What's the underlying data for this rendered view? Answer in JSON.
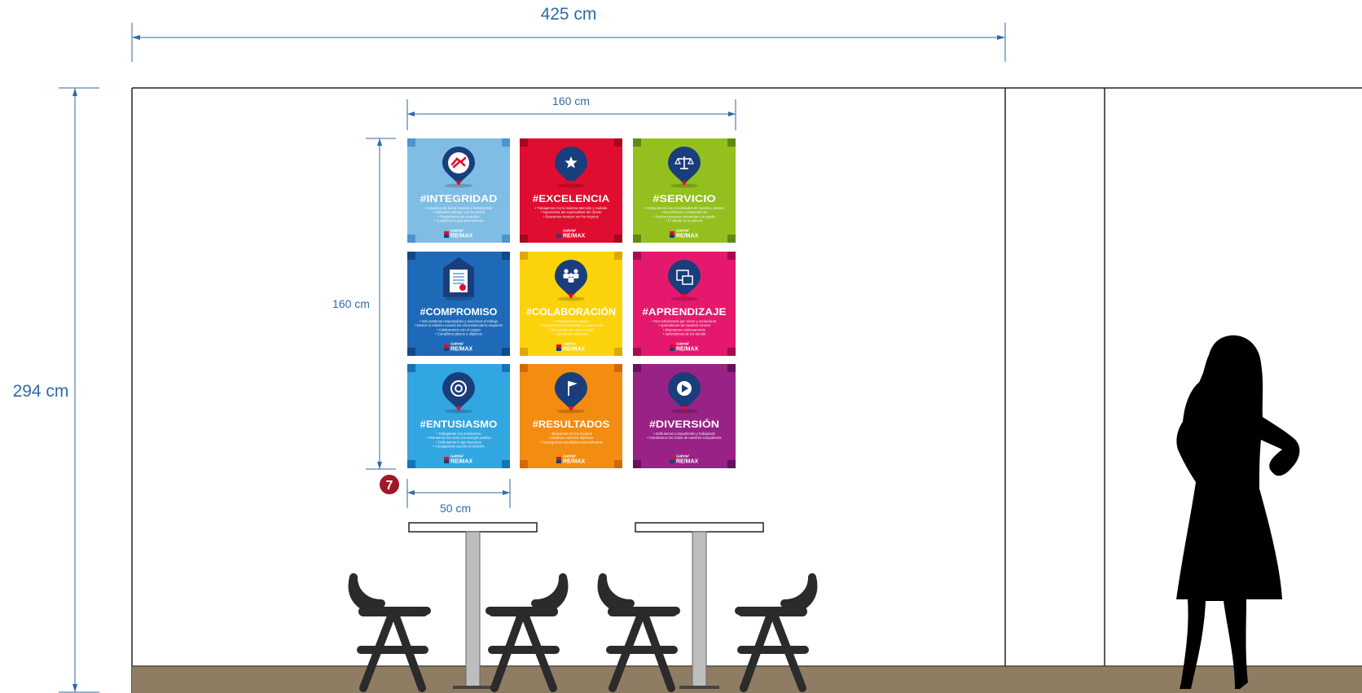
{
  "dimensions": {
    "wall_width": "425 cm",
    "wall_height": "294 cm",
    "grid_width": "160 cm",
    "grid_height": "160 cm",
    "panel_width": "50 cm"
  },
  "badge": "7",
  "colors": {
    "dimension_line": "#2f6aa6",
    "wall_line": "#222222",
    "floor": "#8e7d63",
    "icon_pin": "#1a3e7c",
    "furniture": "#2b2b2b",
    "badge": "#a3162a"
  },
  "logo": {
    "top": "Gabriel",
    "main": "RE/MAX"
  },
  "panels": [
    {
      "title": "#INTEGRIDAD",
      "icon": "handshake-icon",
      "bg": "#7fbde4",
      "corner": "#4d95cf",
      "lines": [
        "Actuamos de forma honesta y transparente",
        "Hablamos siempre con la verdad",
        "Respetamos los acuerdos",
        "Cumplimos lo que prometemos"
      ]
    },
    {
      "title": "#EXCELENCIA",
      "icon": "star-icon",
      "bg": "#df0d2f",
      "corner": "#a80620",
      "lines": [
        "Trabajamos con la máxima atención y cuidado",
        "Superamos las expectativas del cliente",
        "Buscamos siempre ser los mejores"
      ]
    },
    {
      "title": "#SERVICIO",
      "icon": "scales-icon",
      "bg": "#93c01f",
      "corner": "#5f8a14",
      "lines": [
        "Anteponemos las necesidades de nuestros clientes",
        "Escuchamos y respondemos",
        "Somos personas orientadas a la ayuda",
        "El cliente es lo primero"
      ]
    },
    {
      "title": "#COMPROMISO",
      "icon": "certificate-icon",
      "bg": "#1e6ab8",
      "corner": "#0f4a8a",
      "lines": [
        "Nos sentimos responsables y asumimos el trabajo",
        "Damos el máximo cuando las circunstancias lo requieren",
        "Colaboramos con el equipo",
        "Cumplimos plazos y objetivos"
      ]
    },
    {
      "title": "#COLABORACIÓN",
      "icon": "team-icon",
      "bg": "#fcd20b",
      "corner": "#e0a800",
      "lines": [
        "Trabajamos en equipo",
        "Compartimos conocimiento y experiencia",
        "Nos apoyamos unos a otros",
        "Sumamos esfuerzos"
      ]
    },
    {
      "title": "#APRENDIZAJE",
      "icon": "calendar-icon",
      "bg": "#e4196e",
      "corner": "#a30d4c",
      "lines": [
        "Nos esforzamos por crecer y evolucionar",
        "Aprendemos de nuestros errores",
        "Mejoramos continuamente",
        "Aprendemos de los demás"
      ]
    },
    {
      "title": "#ENTUSIASMO",
      "icon": "target-icon",
      "bg": "#32a6e0",
      "corner": "#1573b8",
      "lines": [
        "Trabajamos con entusiasmo",
        "Afrontamos los retos con energía positiva",
        "Disfrutamos lo que hacemos",
        "Contagiamos nuestra motivación"
      ]
    },
    {
      "title": "#RESULTADOS",
      "icon": "flag-icon",
      "bg": "#f28d12",
      "corner": "#d16a06",
      "lines": [
        "Buscamos ser los mejores",
        "Medimos nuestros objetivos",
        "Conseguimos resultados extraordinarios"
      ]
    },
    {
      "title": "#DIVERSIÓN",
      "icon": "play-icon",
      "bg": "#992286",
      "corner": "#66125a",
      "lines": [
        "Disfrutamos compartiendo y trabajando",
        "Celebramos los éxitos de nuestros compañeros"
      ]
    }
  ]
}
